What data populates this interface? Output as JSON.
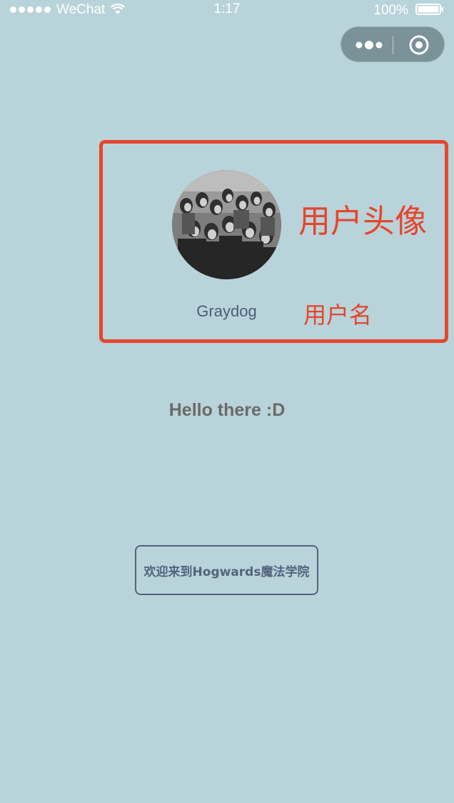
{
  "status_bar": {
    "carrier": "WeChat",
    "time": "1:17",
    "battery_percent": "100%"
  },
  "capsule": {
    "more_icon": "more-dots-icon",
    "close_icon": "close-target-icon"
  },
  "profile": {
    "username": "Graydog",
    "annotation_avatar_label": "用户头像",
    "annotation_username_label": "用户名",
    "annotation_color": "#e5462c"
  },
  "main": {
    "greeting": "Hello there :D",
    "enter_button_label": "欢迎来到Hogwards魔法学院"
  },
  "colors": {
    "background": "#b9d3da",
    "capsule": "#7a9298",
    "button_border": "#52647e"
  }
}
